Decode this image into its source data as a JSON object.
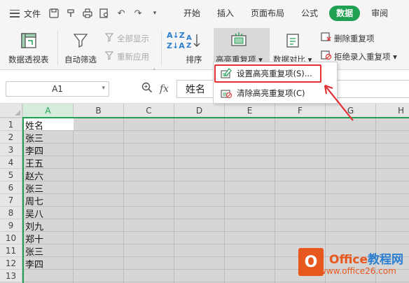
{
  "menubar": {
    "file_label": "文件",
    "tabs": [
      {
        "label": "开始",
        "active": false
      },
      {
        "label": "插入",
        "active": false
      },
      {
        "label": "页面布局",
        "active": false
      },
      {
        "label": "公式",
        "active": false
      },
      {
        "label": "数据",
        "active": true
      },
      {
        "label": "审阅",
        "active": false
      }
    ]
  },
  "ribbon": {
    "pivot_table": "数据透视表",
    "auto_filter": "自动筛选",
    "show_all": "全部显示",
    "reapply": "重新应用",
    "sort": "排序",
    "highlight_duplicates": "高亮重复项",
    "data_compare": "数据对比",
    "remove_duplicates": "删除重复项",
    "reject_duplicates": "拒绝录入重复项"
  },
  "dropdown": {
    "set_highlight": "设置高亮重复项(S)...",
    "clear_highlight": "清除高亮重复项(C)"
  },
  "formula_bar": {
    "name_box": "A1",
    "fx_label": "fx",
    "formula_value": "姓名"
  },
  "sheet": {
    "columns": [
      "A",
      "B",
      "C",
      "D",
      "E",
      "F",
      "G",
      "H"
    ],
    "rows": [
      "1",
      "2",
      "3",
      "4",
      "5",
      "6",
      "7",
      "8",
      "9",
      "10",
      "11",
      "12",
      "13"
    ],
    "column_a_values": [
      "姓名",
      "张三",
      "李四",
      "王五",
      "赵六",
      "张三",
      "周七",
      "吴八",
      "刘九",
      "郑十",
      "张三",
      "李四",
      ""
    ]
  },
  "watermark": {
    "brand_prefix": "Office",
    "brand_suffix": "教程网",
    "sub": "www.office26.com",
    "logo_letter": "O"
  },
  "colors": {
    "accent_green": "#20a053",
    "highlight_red": "#e03030",
    "brand_orange": "#e8571e"
  }
}
